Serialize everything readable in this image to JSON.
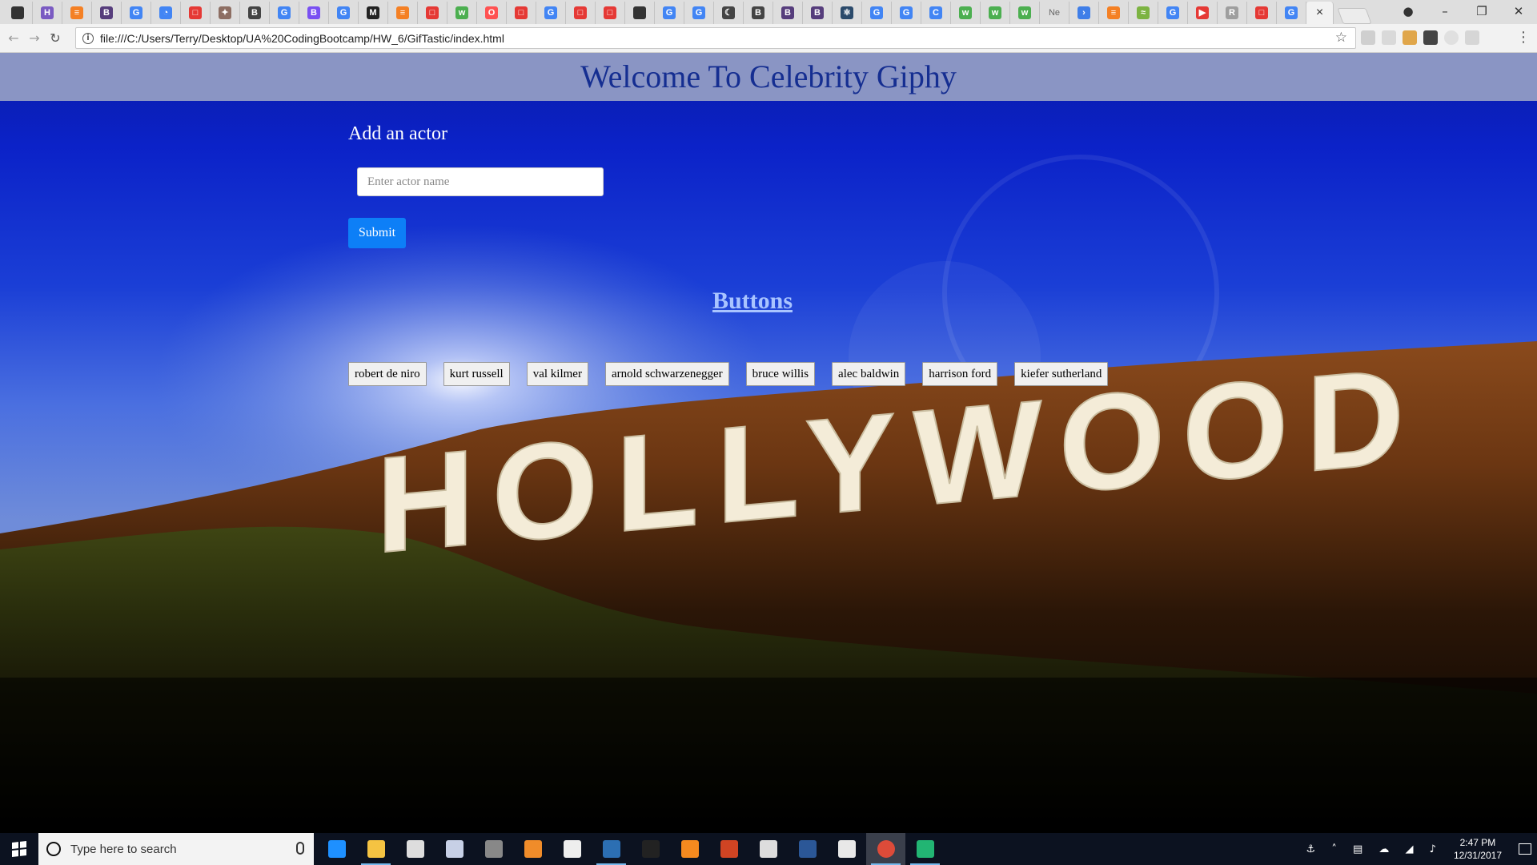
{
  "browser": {
    "tabs": [
      {
        "icon": "github-icon",
        "glyph": "",
        "color": "#333333"
      },
      {
        "icon": "heroku-icon",
        "glyph": "H",
        "color": "#7a5ac2"
      },
      {
        "icon": "stackoverflow-icon",
        "glyph": "≡",
        "color": "#f48024"
      },
      {
        "icon": "bootstrap-icon",
        "glyph": "B",
        "color": "#563d7c"
      },
      {
        "icon": "google-icon",
        "glyph": "G",
        "color": "#4285f4"
      },
      {
        "icon": "loading-icon",
        "glyph": "◔",
        "color": "#4285f4"
      },
      {
        "icon": "codepen-icon",
        "glyph": "□",
        "color": "#e53935"
      },
      {
        "icon": "paw-icon",
        "glyph": "✦",
        "color": "#8d6e63"
      },
      {
        "icon": "bcs-icon",
        "glyph": "B",
        "color": "#444444"
      },
      {
        "icon": "google-icon",
        "glyph": "G",
        "color": "#4285f4"
      },
      {
        "icon": "bootstrap-icon",
        "glyph": "B",
        "color": "#7950f2"
      },
      {
        "icon": "google-icon",
        "glyph": "G",
        "color": "#4285f4"
      },
      {
        "icon": "medium-icon",
        "glyph": "M",
        "color": "#222222"
      },
      {
        "icon": "stackoverflow-icon",
        "glyph": "≡",
        "color": "#f48024"
      },
      {
        "icon": "codepen-icon",
        "glyph": "□",
        "color": "#e53935"
      },
      {
        "icon": "w3schools-icon",
        "glyph": "w",
        "color": "#4caf50"
      },
      {
        "icon": "opera-icon",
        "glyph": "O",
        "color": "#ff5252"
      },
      {
        "icon": "codepen-icon",
        "glyph": "□",
        "color": "#e53935"
      },
      {
        "icon": "google-icon",
        "glyph": "G",
        "color": "#4285f4"
      },
      {
        "icon": "codepen-icon",
        "glyph": "□",
        "color": "#e53935"
      },
      {
        "icon": "codepen-icon",
        "glyph": "□",
        "color": "#e53935"
      },
      {
        "icon": "github-icon",
        "glyph": "",
        "color": "#333333"
      },
      {
        "icon": "google-icon",
        "glyph": "G",
        "color": "#4285f4"
      },
      {
        "icon": "google-icon",
        "glyph": "G",
        "color": "#4285f4"
      },
      {
        "icon": "moon-icon",
        "glyph": "☾",
        "color": "#444444"
      },
      {
        "icon": "bcs-icon",
        "glyph": "B",
        "color": "#444444"
      },
      {
        "icon": "bootstrap-icon",
        "glyph": "B",
        "color": "#563d7c"
      },
      {
        "icon": "bootstrap-icon",
        "glyph": "B",
        "color": "#563d7c"
      },
      {
        "icon": "atom-icon",
        "glyph": "⚛",
        "color": "#2b4a6b"
      },
      {
        "icon": "google-icon",
        "glyph": "G",
        "color": "#4285f4"
      },
      {
        "icon": "google-icon",
        "glyph": "G",
        "color": "#4285f4"
      },
      {
        "icon": "loading-icon",
        "glyph": "C",
        "color": "#4285f4"
      },
      {
        "icon": "w3schools-icon",
        "glyph": "w",
        "color": "#4caf50"
      },
      {
        "icon": "w3schools-icon",
        "glyph": "w",
        "color": "#4caf50"
      },
      {
        "icon": "w3schools-icon",
        "glyph": "w",
        "color": "#4caf50"
      },
      {
        "icon": "new-tab-icon",
        "glyph": "Ne",
        "color": "#dedede"
      },
      {
        "icon": "arrow-icon",
        "glyph": "›",
        "color": "#3f7ee8"
      },
      {
        "icon": "stackoverflow-icon",
        "glyph": "≡",
        "color": "#f48024"
      },
      {
        "icon": "feather-icon",
        "glyph": "≈",
        "color": "#7cb342"
      },
      {
        "icon": "google-icon",
        "glyph": "G",
        "color": "#4285f4"
      },
      {
        "icon": "youtube-icon",
        "glyph": "▶",
        "color": "#e53935"
      },
      {
        "icon": "r-icon",
        "glyph": "R",
        "color": "#9e9e9e"
      },
      {
        "icon": "codepen-icon",
        "glyph": "□",
        "color": "#e53935"
      },
      {
        "icon": "google-icon",
        "glyph": "G",
        "color": "#4285f4"
      }
    ],
    "active_tab_close": "×",
    "window_controls": {
      "profile": "●",
      "minimize": "–",
      "restore": "❐",
      "close": "✕"
    },
    "nav": {
      "back": "←",
      "forward": "→",
      "reload": "↻"
    },
    "url": "file:///C:/Users/Terry/Desktop/UA%20CodingBootcamp/HW_6/GifTastic/index.html",
    "menu": "⋮"
  },
  "page": {
    "title": "Welcome To Celebrity Giphy",
    "add_label": "Add an actor",
    "input_placeholder": "Enter actor name",
    "submit_label": "Submit",
    "buttons_heading": "Buttons",
    "actors": [
      "robert de niro",
      "kurt russell",
      "val kilmer",
      "arnold schwarzenegger",
      "bruce willis",
      "alec baldwin",
      "harrison ford",
      "kiefer sutherland"
    ],
    "background_sign": "HOLLYWOOD",
    "colors": {
      "header_bg": "#8a95c4",
      "title": "#152e91",
      "submit": "#0d7ff7",
      "heading": "#a9c4ff"
    }
  },
  "taskbar": {
    "search_placeholder": "Type here to search",
    "apps": [
      {
        "icon": "edge-icon",
        "color": "#1e90ff",
        "open": false
      },
      {
        "icon": "file-explorer-icon",
        "color": "#f5c342",
        "open": true
      },
      {
        "icon": "store-icon",
        "color": "#dddddd",
        "open": false
      },
      {
        "icon": "people-icon",
        "color": "#c7d0e6",
        "open": false
      },
      {
        "icon": "snip-icon",
        "color": "#888888",
        "open": false
      },
      {
        "icon": "media-icon",
        "color": "#f08c2a",
        "open": false
      },
      {
        "icon": "mail-icon",
        "color": "#eeeeee",
        "open": false
      },
      {
        "icon": "vscode-icon",
        "color": "#2c6fb3",
        "open": true
      },
      {
        "icon": "terminal-icon",
        "color": "#222222",
        "open": false
      },
      {
        "icon": "sublime-icon",
        "color": "#f58a1f",
        "open": false
      },
      {
        "icon": "powerpoint-icon",
        "color": "#d04423",
        "open": false
      },
      {
        "icon": "settings-icon",
        "color": "#dddddd",
        "open": false
      },
      {
        "icon": "word-icon",
        "color": "#2b5797",
        "open": false
      },
      {
        "icon": "slack-icon",
        "color": "#e8e8e8",
        "open": false
      },
      {
        "icon": "chrome-icon",
        "color": "#dd4b39",
        "open": true,
        "active": true
      },
      {
        "icon": "gitkraken-icon",
        "color": "#22b573",
        "open": true
      }
    ],
    "tray_icons": "⚓ ˄ ▤ ☁ ◢ ♪",
    "time": "2:47 PM",
    "date": "12/31/2017"
  }
}
